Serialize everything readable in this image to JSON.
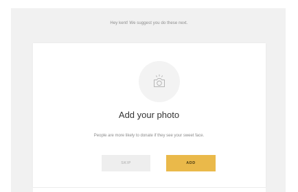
{
  "header": {
    "suggestion": "Hey kent! We suggest you do these next."
  },
  "card": {
    "icon": "camera-icon",
    "title": "Add your photo",
    "description": "People are more likely to donate if they see your sweet face.",
    "buttons": {
      "skip_label": "SKIP",
      "add_label": "ADD"
    }
  },
  "colors": {
    "accent": "#eab94a",
    "skip_bg": "#eeeeee",
    "panel_bg": "#f1f1f1",
    "title_text": "#333333",
    "muted_text": "#8a8a8a"
  }
}
